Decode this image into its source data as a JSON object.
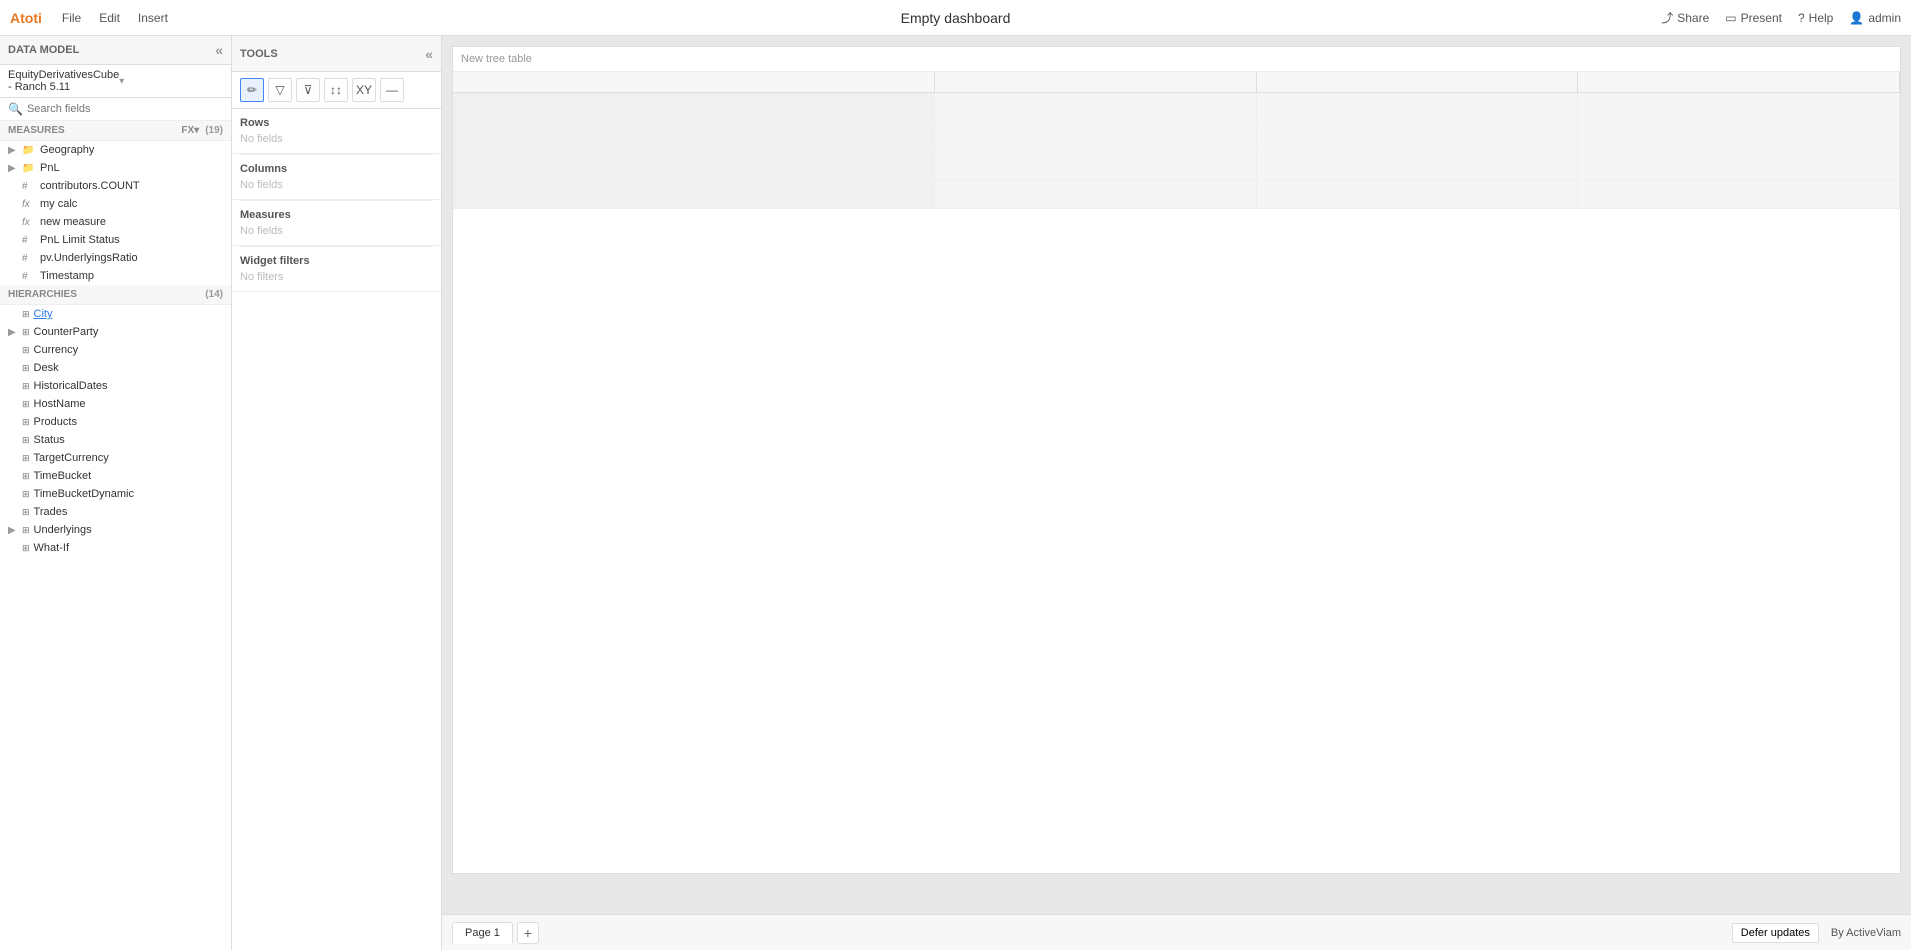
{
  "app": {
    "logo": "Atoti",
    "nav": {
      "file": "File",
      "edit": "Edit",
      "insert": "Insert"
    },
    "title": "Empty dashboard",
    "actions": {
      "share": "Share",
      "present": "Present",
      "help": "Help",
      "user": "admin"
    }
  },
  "left_panel": {
    "header": "DATA MODEL",
    "cube": "EquityDerivativesCube - Ranch 5.11",
    "search_placeholder": "Search fields",
    "measures_header": "MEASURES",
    "measures_count": "(19)",
    "measures": [
      {
        "type": "folder",
        "name": "Geography",
        "indent": 0
      },
      {
        "type": "folder",
        "name": "PnL",
        "indent": 0
      },
      {
        "type": "hash",
        "name": "contributors.COUNT",
        "indent": 0
      },
      {
        "type": "fx",
        "name": "my calc",
        "indent": 0
      },
      {
        "type": "fx",
        "name": "new measure",
        "indent": 0
      },
      {
        "type": "hash",
        "name": "PnL Limit Status",
        "indent": 0
      },
      {
        "type": "hash",
        "name": "pv.UnderlyingsRatio",
        "indent": 0
      },
      {
        "type": "hash",
        "name": "Timestamp",
        "indent": 0
      }
    ],
    "hierarchies_header": "HIERARCHIES",
    "hierarchies_count": "(14)",
    "hierarchies": [
      {
        "name": "City",
        "underline": true
      },
      {
        "name": "CounterParty",
        "underline": false
      },
      {
        "name": "Currency",
        "underline": false
      },
      {
        "name": "Desk",
        "underline": false
      },
      {
        "name": "HistoricalDates",
        "underline": false
      },
      {
        "name": "HostName",
        "underline": false
      },
      {
        "name": "Products",
        "underline": false
      },
      {
        "name": "Status",
        "underline": false
      },
      {
        "name": "TargetCurrency",
        "underline": false
      },
      {
        "name": "TimeBucket",
        "underline": false
      },
      {
        "name": "TimeBucketDynamic",
        "underline": false
      },
      {
        "name": "Trades",
        "underline": false
      },
      {
        "name": "Underlyings",
        "underline": false
      },
      {
        "name": "What-If",
        "underline": false
      }
    ]
  },
  "tools_panel": {
    "header": "TOOLS",
    "toolbar": {
      "buttons": [
        {
          "name": "edit-icon",
          "label": "✏"
        },
        {
          "name": "filter-icon",
          "label": "▽"
        },
        {
          "name": "conditional-filter-icon",
          "label": "⊽"
        },
        {
          "name": "sort-icon",
          "label": "↕"
        },
        {
          "name": "xy-icon",
          "label": "XY"
        },
        {
          "name": "minus-icon",
          "label": "—"
        }
      ]
    },
    "rows": {
      "title": "Rows",
      "empty_text": "No fields"
    },
    "columns": {
      "title": "Columns",
      "empty_text": "No fields"
    },
    "measures": {
      "title": "Measures",
      "empty_text": "No fields"
    },
    "widget_filters": {
      "title": "Widget filters",
      "empty_text": "No filters"
    }
  },
  "canvas": {
    "widget_title": "New tree table",
    "pages": [
      {
        "label": "Page 1",
        "active": true
      }
    ],
    "add_page_label": "+",
    "footer_right": {
      "defer_updates": "Defer updates",
      "brand": "By ActiveViam"
    }
  }
}
